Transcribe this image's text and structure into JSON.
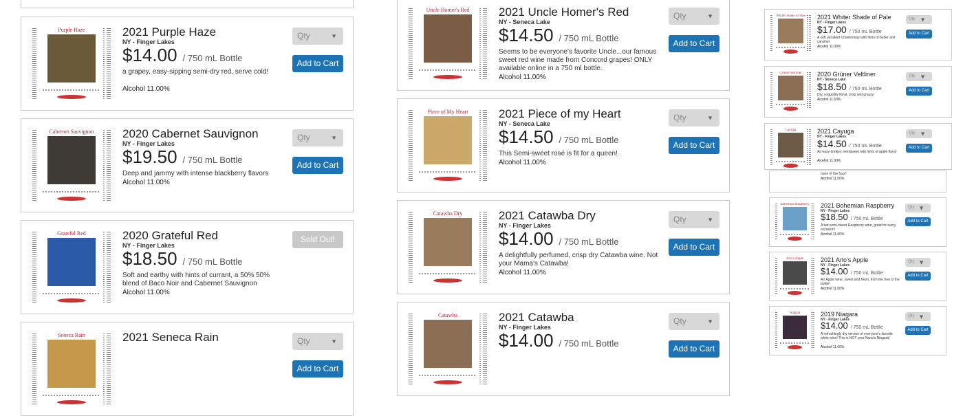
{
  "common": {
    "bottle_unit": "/ 750 mL Bottle",
    "qty_placeholder": "Qty",
    "add_label": "Add to Cart",
    "sold_label": "Sold Out!"
  },
  "left_column": [
    {
      "label_title": "Purple Haze",
      "title": "2021 Purple Haze",
      "region": "NY - Finger Lakes",
      "price": "$14.00",
      "desc": "a grapey, easy-sipping semi-dry red, serve cold!",
      "alcohol": "Alcohol 11.00%",
      "status": "available"
    },
    {
      "label_title": "Cabernet Sauvignon",
      "title": "2020 Cabernet Sauvignon",
      "region": "NY - Finger Lakes",
      "price": "$19.50",
      "desc": "Deep and jammy with intense blackberry flavors",
      "alcohol": "Alcohol 11.00%",
      "status": "available"
    },
    {
      "label_title": "Grateful Red",
      "title": "2020 Grateful Red",
      "region": "NY - Finger Lakes",
      "price": "$18.50",
      "desc": "Soft and earthy with hints of currant, a 50% 50% blend of Baco Noir and Cabernet Sauvignon",
      "alcohol": "Alcohol 11.00%",
      "status": "sold"
    },
    {
      "label_title": "Seneca Rain",
      "title": "2021 Seneca Rain",
      "region": "",
      "price": "",
      "desc": "",
      "alcohol": "",
      "status": "available"
    }
  ],
  "middle_column": [
    {
      "label_title": "Uncle Homer's Red",
      "title": "2021 Uncle Homer's Red",
      "region": "NY - Seneca Lake",
      "price": "$14.50",
      "desc": "Seems to be everyone's favorite Uncle...our famous sweet red wine made from Concord grapes! ONLY available online in a 750 ml bottle.",
      "alcohol": "Alcohol 11.00%",
      "status": "available"
    },
    {
      "label_title": "Piece of My Heart",
      "title": "2021 Piece of my Heart",
      "region": "NY - Seneca Lake",
      "price": "$14.50",
      "desc": "This Semi-sweet rosé is fit for a queen!",
      "alcohol": "Alcohol 11.00%",
      "status": "available"
    },
    {
      "label_title": "Catawba Dry",
      "title": "2021 Catawba Dry",
      "region": "NY - Finger Lakes",
      "price": "$14.00",
      "desc": "A delightfully perfumed, crisp dry Catawba wine. Not your Mama's Catawba!",
      "alcohol": "Alcohol 11.00%",
      "status": "available"
    },
    {
      "label_title": "Catawba",
      "title": "2021 Catawba",
      "region": "NY - Finger Lakes",
      "price": "$14.00",
      "desc": "",
      "alcohol": "",
      "status": "available"
    }
  ],
  "right_column": [
    {
      "label_title": "Whiter Shade of Pale",
      "title": "2021 Whiter Shade of Pale",
      "region": "NY - Finger Lakes",
      "price": "$17.00",
      "desc": "A soft unoaked Chardonnay with hints of butter and caramel",
      "alcohol": "Alcohol 11.00%",
      "status": "available"
    },
    {
      "label_title": "Grüner Veltliner",
      "title": "2020 Grüner Veltliner",
      "region": "NY - Seneca Lake",
      "price": "$18.50",
      "desc": "Dry, exquisitly floral, crisp and grassy",
      "alcohol": "Alcohol 11.50%",
      "status": "available"
    },
    {
      "label_title": "Cayuga",
      "title": "2021 Cayuga",
      "region": "NY - Finger Lakes",
      "price": "$14.50",
      "desc": "An easy drinker, semisweet with hints of apple flavor",
      "alcohol": "Alcohol 11.00%",
      "status": "available"
    },
    {
      "label_title": "",
      "title": "",
      "region": "",
      "price": "",
      "desc": "none of the fuzz!",
      "alcohol": "Alcohol 11.00%",
      "status": "partial"
    },
    {
      "label_title": "Bohemian Raspberry",
      "title": "2021 Bohemian Raspberry",
      "region": "NY - Finger Lakes",
      "price": "$18.50",
      "desc": "A tart semi-sweet Raspberry wine, great for every occasion!",
      "alcohol": "Alcohol 11.00%",
      "status": "available"
    },
    {
      "label_title": "Arlo's Apple",
      "title": "2021 Arlo's Apple",
      "region": "NY - Finger Lakes",
      "price": "$14.00",
      "desc": "An Apple wine, sweet and fresh, from the tree to the bottle!",
      "alcohol": "Alcohol 11.00%",
      "status": "available"
    },
    {
      "label_title": "Niagara",
      "title": "2019 Niagara",
      "region": "NY - Finger Lakes",
      "price": "$14.00",
      "desc": "A refreshingly dry version of everyone's favorite white wine! This is NOT your Nana's Niagara!",
      "alcohol": "Alcohol 11.00%",
      "status": "available"
    }
  ],
  "colors": {
    "button": "#1e73b5",
    "sold_out": "#c8c8c8",
    "qty_bg": "#d8d8d8",
    "label_title": "#b22233"
  }
}
